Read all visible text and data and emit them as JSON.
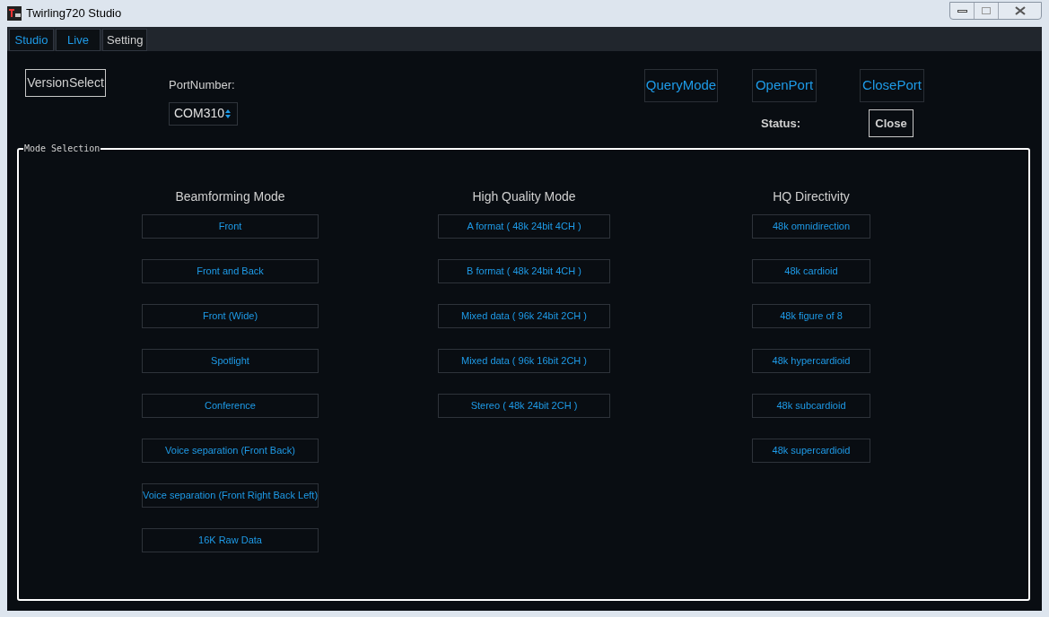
{
  "window": {
    "title": "Twirling720 Studio"
  },
  "tabs": [
    {
      "label": "Studio",
      "selected": false
    },
    {
      "label": "Live",
      "selected": false
    },
    {
      "label": "Setting",
      "selected": true
    }
  ],
  "version_button": "VersionSelect",
  "port": {
    "label": "PortNumber:",
    "value": "COM310"
  },
  "port_buttons": [
    "QueryMode",
    "OpenPort",
    "ClosePort"
  ],
  "status": {
    "label": "Status:",
    "value": "Close"
  },
  "mode_selection": {
    "title": "Mode Selection",
    "columns": [
      {
        "heading": "Beamforming Mode",
        "modes": [
          "Front",
          "Front and Back",
          "Front (Wide)",
          "Spotlight",
          "Conference",
          "Voice separation (Front Back)",
          "Voice separation (Front Right Back Left)",
          "16K Raw Data"
        ]
      },
      {
        "heading": "High Quality Mode",
        "modes": [
          "A format ( 48k 24bit 4CH )",
          "B format ( 48k 24bit 4CH )",
          "Mixed data ( 96k 24bit 2CH )",
          "Mixed data ( 96k 16bit 2CH )",
          "Stereo ( 48k 24bit 2CH )"
        ]
      },
      {
        "heading": "HQ Directivity",
        "modes": [
          "48k omnidirection",
          "48k cardioid",
          "48k figure of 8",
          "48k hypercardioid",
          "48k subcardioid",
          "48k supercardioid"
        ]
      }
    ]
  }
}
